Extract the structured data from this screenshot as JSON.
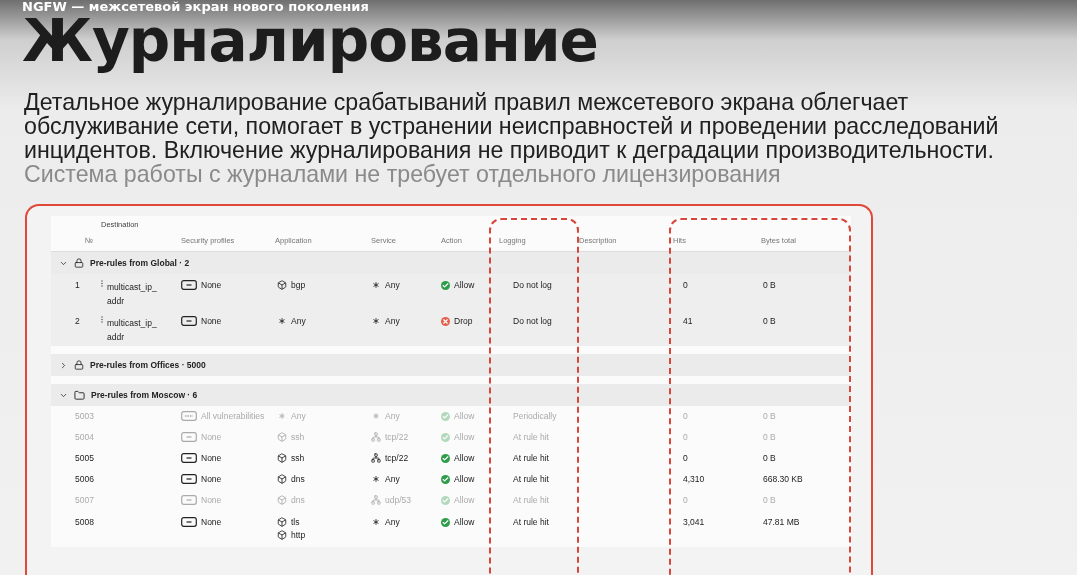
{
  "slide": {
    "kicker": "NGFW — межсетевой экран нового поколения",
    "title": "Журналирование",
    "lead": "Детальное журналирование срабатываний правил межсетевого экрана облегчает обслуживание сети, помогает в устранении неисправностей и проведении расследований инцидентов. Включение журналирования не приводит к деградации производительности.",
    "note": "Система работы с журналами не требует отдельного лицензирования"
  },
  "table": {
    "header_top": "Destination",
    "columns": [
      "№",
      "Security profiles",
      "Application",
      "Service",
      "Action",
      "Logging",
      "Description",
      "Hits",
      "Bytes total"
    ],
    "groups": [
      {
        "kind": "lock",
        "label": "Pre-rules from Global · 2",
        "expanded": true,
        "rules": [
          {
            "number": "1",
            "destination": "multicast_ip_addr",
            "profile": {
              "kind": "none",
              "label": "None"
            },
            "apps": [
              {
                "kind": "app",
                "name": "bgp"
              }
            ],
            "service": {
              "kind": "any",
              "name": "Any"
            },
            "action": {
              "kind": "allow",
              "label": "Allow"
            },
            "logging": "Do not log",
            "hits": "0",
            "bytes": "0 B",
            "disabled": false
          },
          {
            "number": "2",
            "destination": "multicast_ip_addr",
            "profile": {
              "kind": "none",
              "label": "None"
            },
            "apps": [
              {
                "kind": "any",
                "name": "Any"
              }
            ],
            "service": {
              "kind": "any",
              "name": "Any"
            },
            "action": {
              "kind": "drop",
              "label": "Drop"
            },
            "logging": "Do not log",
            "hits": "41",
            "bytes": "0 B",
            "disabled": false
          }
        ]
      },
      {
        "kind": "lock",
        "label": "Pre-rules from Offices · 5000",
        "expanded": false
      },
      {
        "kind": "folder",
        "label": "Pre-rules from Moscow · 6",
        "expanded": true,
        "rules": [
          {
            "number": "5003",
            "profile": {
              "kind": "ips",
              "label": "All vulnerabilities"
            },
            "apps": [
              {
                "kind": "any",
                "name": "Any"
              }
            ],
            "service": {
              "kind": "any",
              "name": "Any"
            },
            "action": {
              "kind": "allow",
              "label": "Allow"
            },
            "logging": "Periodically",
            "hits": "0",
            "bytes": "0 B",
            "disabled": true
          },
          {
            "number": "5004",
            "profile": {
              "kind": "none",
              "label": "None"
            },
            "apps": [
              {
                "kind": "app",
                "name": "ssh"
              }
            ],
            "service": {
              "kind": "port",
              "name": "tcp/22"
            },
            "action": {
              "kind": "allow",
              "label": "Allow"
            },
            "logging": "At rule hit",
            "hits": "0",
            "bytes": "0 B",
            "disabled": true
          },
          {
            "number": "5005",
            "profile": {
              "kind": "none",
              "label": "None"
            },
            "apps": [
              {
                "kind": "app",
                "name": "ssh"
              }
            ],
            "service": {
              "kind": "port",
              "name": "tcp/22"
            },
            "action": {
              "kind": "allow",
              "label": "Allow"
            },
            "logging": "At rule hit",
            "hits": "0",
            "bytes": "0 B",
            "disabled": false
          },
          {
            "number": "5006",
            "profile": {
              "kind": "none",
              "label": "None"
            },
            "apps": [
              {
                "kind": "app",
                "name": "dns"
              }
            ],
            "service": {
              "kind": "any",
              "name": "Any"
            },
            "action": {
              "kind": "allow",
              "label": "Allow"
            },
            "logging": "At rule hit",
            "hits": "4,310",
            "bytes": "668.30 KB",
            "disabled": false
          },
          {
            "number": "5007",
            "profile": {
              "kind": "none",
              "label": "None"
            },
            "apps": [
              {
                "kind": "app",
                "name": "dns"
              }
            ],
            "service": {
              "kind": "port",
              "name": "udp/53"
            },
            "action": {
              "kind": "allow",
              "label": "Allow"
            },
            "logging": "At rule hit",
            "hits": "0",
            "bytes": "0 B",
            "disabled": true
          },
          {
            "number": "5008",
            "profile": {
              "kind": "none",
              "label": "None"
            },
            "apps": [
              {
                "kind": "app",
                "name": "tls"
              },
              {
                "kind": "app",
                "name": "http"
              }
            ],
            "service": {
              "kind": "any",
              "name": "Any"
            },
            "action": {
              "kind": "allow",
              "label": "Allow"
            },
            "logging": "At rule hit",
            "hits": "3,041",
            "bytes": "47.81 MB",
            "disabled": false
          }
        ]
      }
    ]
  }
}
